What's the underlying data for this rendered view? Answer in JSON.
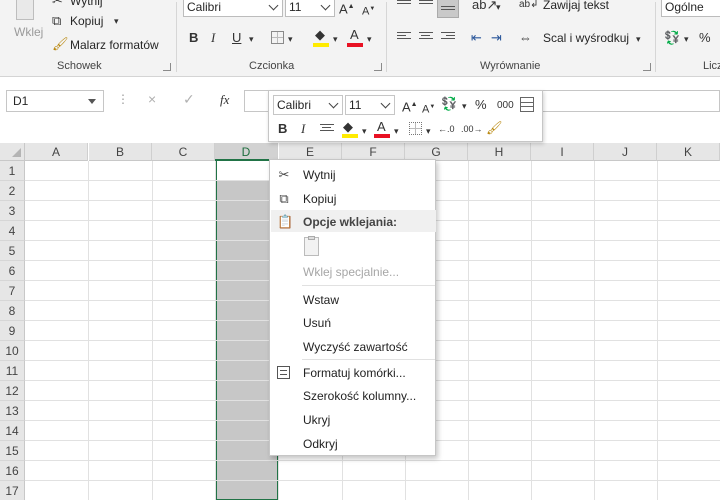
{
  "ribbon": {
    "clipboard": {
      "paste_label": "Wklej",
      "cut_label": "Wytnij",
      "copy_label": "Kopiuj",
      "format_painter_label": "Malarz formatów",
      "group_label": "Schowek"
    },
    "font": {
      "font_name": "Calibri",
      "font_size": "11",
      "group_label": "Czcionka",
      "bold": "B",
      "italic": "I",
      "underline": "U"
    },
    "alignment": {
      "wrap_text_label": "Zawijaj tekst",
      "merge_center_label": "Scal i wyśrodkuj",
      "group_label": "Wyrównanie"
    },
    "number": {
      "format_value": "Ogólne",
      "group_label_partial": "Licz",
      "percent": "%"
    }
  },
  "formula_bar": {
    "name_box": "D1",
    "fx_label": "fx",
    "cancel_icon": "×",
    "enter_icon": "✓",
    "dots": "⋮"
  },
  "grid": {
    "columns": [
      "A",
      "B",
      "C",
      "D",
      "E",
      "F",
      "G",
      "H",
      "I",
      "J",
      "K"
    ],
    "rows": [
      "1",
      "2",
      "3",
      "4",
      "5",
      "6",
      "7",
      "8",
      "9",
      "10",
      "11",
      "12",
      "13",
      "14",
      "15",
      "16",
      "17"
    ],
    "selected_column": "D"
  },
  "mini_toolbar": {
    "font_name": "Calibri",
    "font_size": "11",
    "percent": "%",
    "thousands": "000",
    "bold": "B",
    "italic": "I"
  },
  "context_menu": {
    "cut": "Wytnij",
    "copy": "Kopiuj",
    "paste_options_header": "Opcje wklejania:",
    "paste_special": "Wklej specjalnie...",
    "insert": "Wstaw",
    "delete": "Usuń",
    "clear_contents": "Wyczyść zawartość",
    "format_cells": "Formatuj komórki...",
    "column_width": "Szerokość kolumny...",
    "hide": "Ukryj",
    "unhide": "Odkryj"
  },
  "colors": {
    "excel_green": "#217346",
    "font_color_red": "#e81123",
    "highlight_yellow": "#ffeb00",
    "selection_gray": "#c7c7c7"
  }
}
